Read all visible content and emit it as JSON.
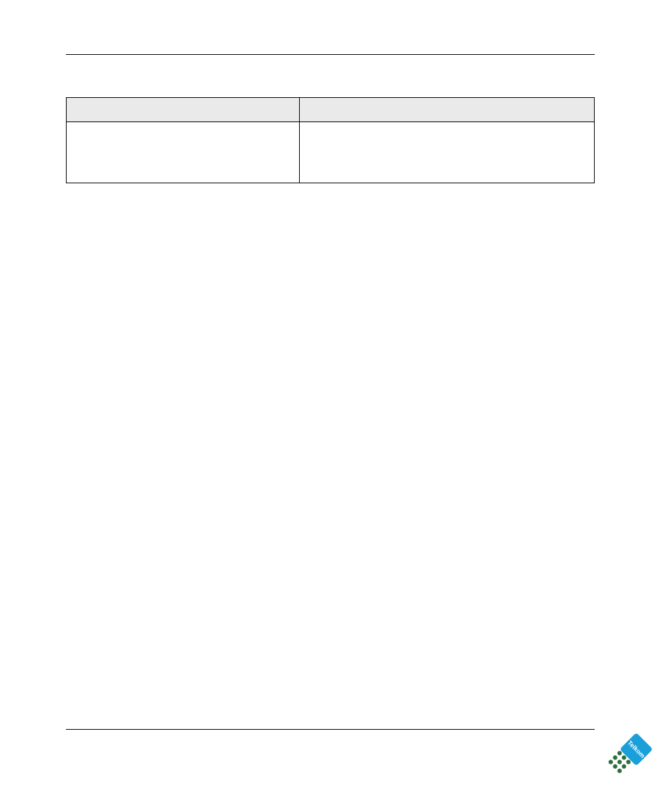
{
  "table": {
    "headers": [
      "",
      ""
    ],
    "row": [
      "",
      ""
    ]
  },
  "logo": {
    "label": "Telkom",
    "brand_color": "#19a0db",
    "keypad_color": "#2d6f3c"
  }
}
